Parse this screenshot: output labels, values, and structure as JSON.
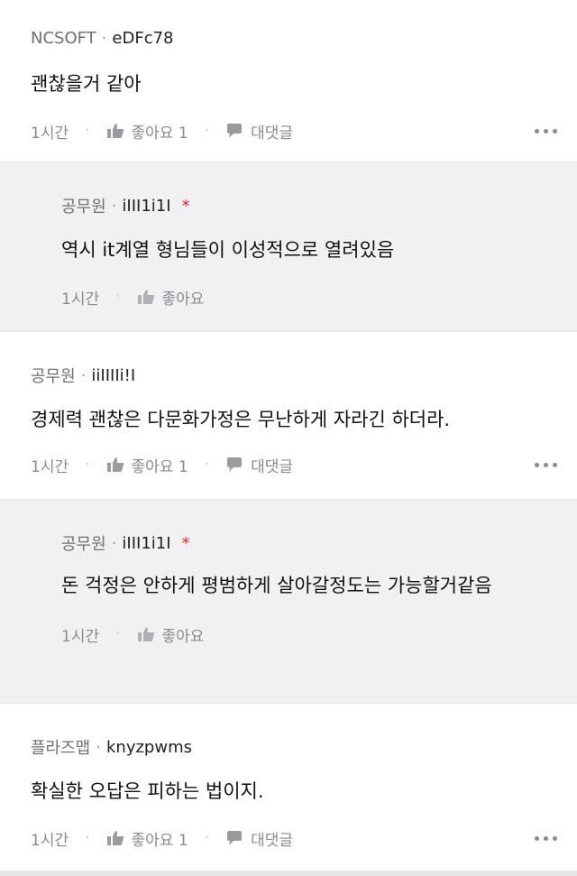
{
  "comments": [
    {
      "author": "NCSOFT",
      "uid": "eDFc78",
      "star": "",
      "text": "괜찮을거 같아",
      "time": "1시간",
      "like": "좋아요 1",
      "reply": "대댓글"
    },
    {
      "author": "공무원",
      "uid": "iIII1i1I",
      "star": "*",
      "text": "역시 it계열 형님들이 이성적으로 열려있음",
      "time": "1시간",
      "like": "좋아요"
    },
    {
      "author": "공무원",
      "uid": "iiIIIIi!I",
      "text": "경제력 괜찮은 다문화가정은 무난하게 자라긴 하더라.",
      "time": "1시간",
      "like": "좋아요 1",
      "reply": "대댓글"
    },
    {
      "author": "공무원",
      "uid": "iIII1i1I",
      "star": "*",
      "text": "돈 걱정은 안하게 평범하게 살아갈정도는 가능할거같음",
      "time": "1시간",
      "like": "좋아요"
    },
    {
      "author": "플라즈맵",
      "uid": "knyzpwms",
      "text": "확실한 오답은 피하는 법이지.",
      "time": "1시간",
      "like": "좋아요 1",
      "reply": "대댓글"
    }
  ],
  "icons": {
    "like": "thumbs-up-icon",
    "reply": "speech-bubble-icon",
    "more": "more-dots-icon"
  }
}
